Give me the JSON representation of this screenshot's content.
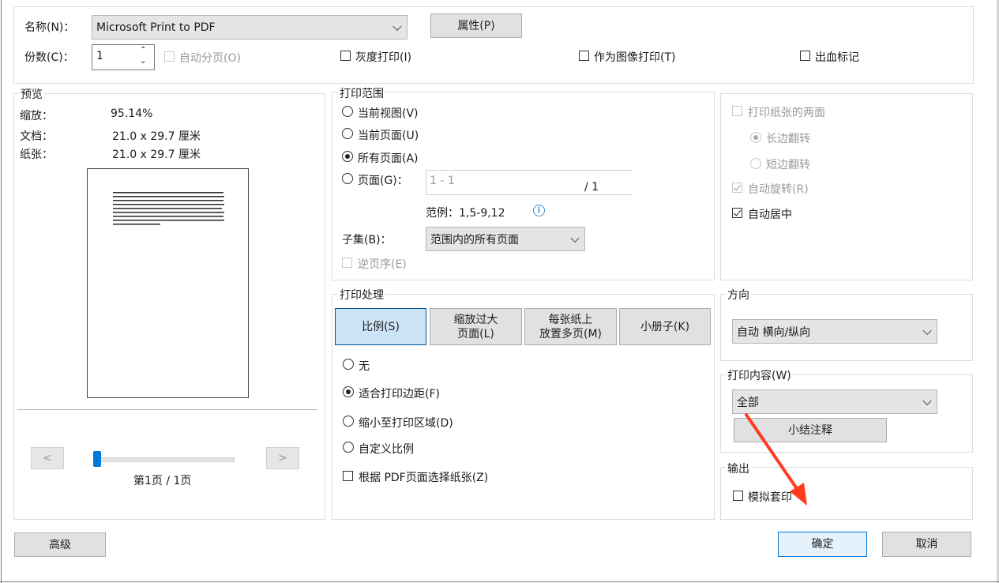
{
  "printer": {
    "label": "名称(N)：",
    "value": "Microsoft Print to PDF",
    "properties_button": "属性(P)"
  },
  "copies": {
    "label": "份数(C)：",
    "value": "1",
    "collate": "自动分页(O)"
  },
  "options_row": {
    "grayscale": "灰度打印(I)",
    "as_image": "作为图像打印(T)",
    "bleed_marks": "出血标记"
  },
  "preview": {
    "legend": "预览",
    "zoom_label": "缩放：",
    "zoom_value": "95.14%",
    "doc_label": "文档：",
    "doc_value": "21.0 x 29.7 厘米",
    "paper_label": "纸张：",
    "paper_value": "21.0 x 29.7 厘米",
    "prev_button": "<",
    "next_button": ">",
    "page_indicator": "第1页 / 1页",
    "slider_position": 0
  },
  "print_range": {
    "legend": "打印范围",
    "current_view": "当前视图(V)",
    "current_page": "当前页面(U)",
    "all_pages": "所有页面(A)",
    "pages": "页面(G)：",
    "pages_input_value": "1 - 1",
    "pages_total": "/ 1",
    "example": "范例：1,5-9,12",
    "subset_label": "子集(B)：",
    "subset_value": "范围内的所有页面",
    "reverse": "逆页序(E)",
    "selected": "all_pages"
  },
  "duplex": {
    "print_both_sides": "打印纸张的两面",
    "long_edge": "长边翻转",
    "short_edge": "短边翻转",
    "auto_rotate": "自动旋转(R)",
    "auto_center": "自动居中"
  },
  "print_handling": {
    "legend": "打印处理",
    "tabs": {
      "scale": "比例(S)",
      "oversize_line1": "缩放过大",
      "oversize_line2": "页面(L)",
      "multiple_line1": "每张纸上",
      "multiple_line2": "放置多页(M)",
      "booklet": "小册子(K)"
    },
    "none": "无",
    "fit_margins": "适合打印边距(F)",
    "shrink_area": "缩小至打印区域(D)",
    "custom_scale": "自定义比例",
    "choose_paper": "根据 PDF页面选择纸张(Z)",
    "selected": "fit_margins"
  },
  "orientation": {
    "legend": "方向",
    "value": "自动 横向/纵向"
  },
  "print_content": {
    "legend": "打印内容(W)",
    "value": "全部",
    "summarize_button": "小结注释"
  },
  "output": {
    "legend": "输出",
    "simulate_overprint": "模拟套印"
  },
  "footer": {
    "advanced": "高级",
    "ok": "确定",
    "cancel": "取消"
  },
  "colors": {
    "accent": "#0078d7",
    "arrow": "#ff3b1f",
    "info_icon": "#3b8fd6"
  }
}
